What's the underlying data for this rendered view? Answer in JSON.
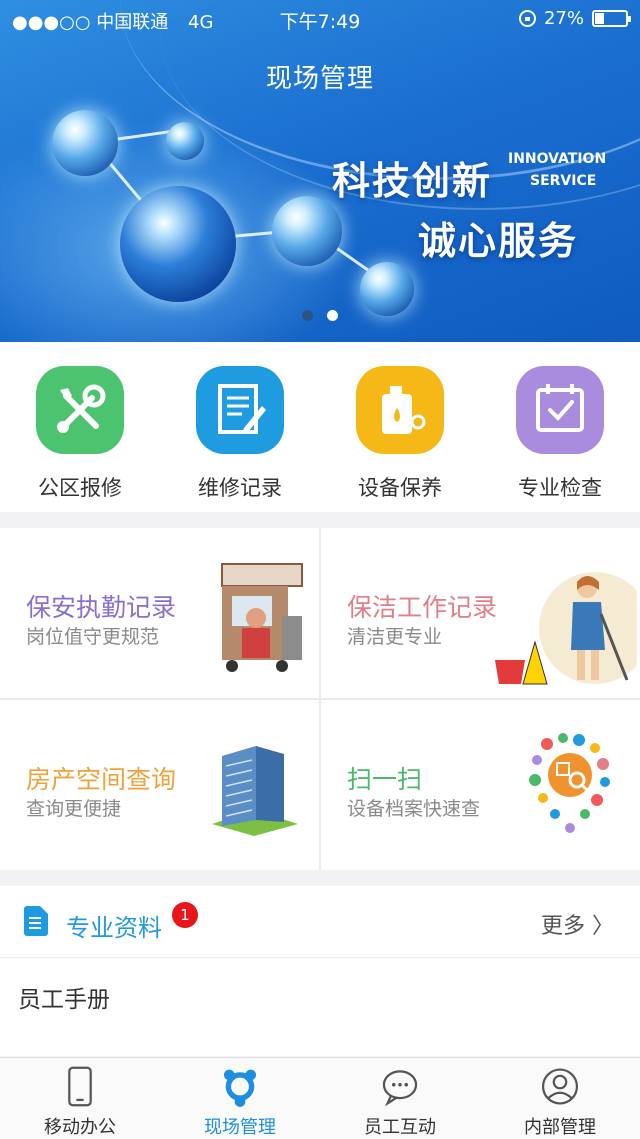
{
  "status_bar": {
    "carrier": "●●●○○ 中国联通",
    "network": "4G",
    "time": "下午7:49",
    "battery": "27%",
    "battery_level": 0.27
  },
  "header": {
    "title": "现场管理"
  },
  "banner": {
    "slogan_cn_1": "科技创新",
    "slogan_cn_2": "诚心服务",
    "slogan_en_1": "INNOVATION",
    "slogan_en_2": "SERVICE",
    "page_count": 2,
    "active_page": 2
  },
  "quick_actions": [
    {
      "label": "公区报修",
      "icon": "wrench-screwdriver-icon",
      "color": "#4cc36e"
    },
    {
      "label": "维修记录",
      "icon": "document-edit-icon",
      "color": "#1f9be0"
    },
    {
      "label": "设备保养",
      "icon": "oil-can-icon",
      "color": "#f6b817"
    },
    {
      "label": "专业检查",
      "icon": "calendar-check-icon",
      "color": "#a98cde"
    }
  ],
  "cards": [
    {
      "title": "保安执勤记录",
      "subtitle": "岗位值守更规范",
      "title_color": "#8a6ed0",
      "illustration": "parking-booth-illustration"
    },
    {
      "title": "保洁工作记录",
      "subtitle": "清洁更专业",
      "title_color": "#e27e87",
      "illustration": "cleaner-illustration"
    },
    {
      "title": "房产空间查询",
      "subtitle": "查询更便捷",
      "title_color": "#f0a23a",
      "illustration": "building-illustration"
    },
    {
      "title": "扫一扫",
      "subtitle": "设备档案快速查",
      "title_color": "#4cb86a",
      "illustration": "qr-scan-illustration"
    }
  ],
  "resources": {
    "title": "专业资料",
    "badge": "1",
    "more": "更多 〉",
    "items": [
      "员工手册"
    ]
  },
  "tabbar": {
    "tabs": [
      {
        "label": "移动办公",
        "icon": "phone-icon",
        "active": false
      },
      {
        "label": "现场管理",
        "icon": "field-management-icon",
        "active": true
      },
      {
        "label": "员工互动",
        "icon": "chat-bubble-icon",
        "active": false
      },
      {
        "label": "内部管理",
        "icon": "user-profile-icon",
        "active": false
      }
    ]
  },
  "colors": {
    "accent": "#1e8fe0",
    "banner": "#1b6fd0",
    "badge": "#e8151b"
  }
}
